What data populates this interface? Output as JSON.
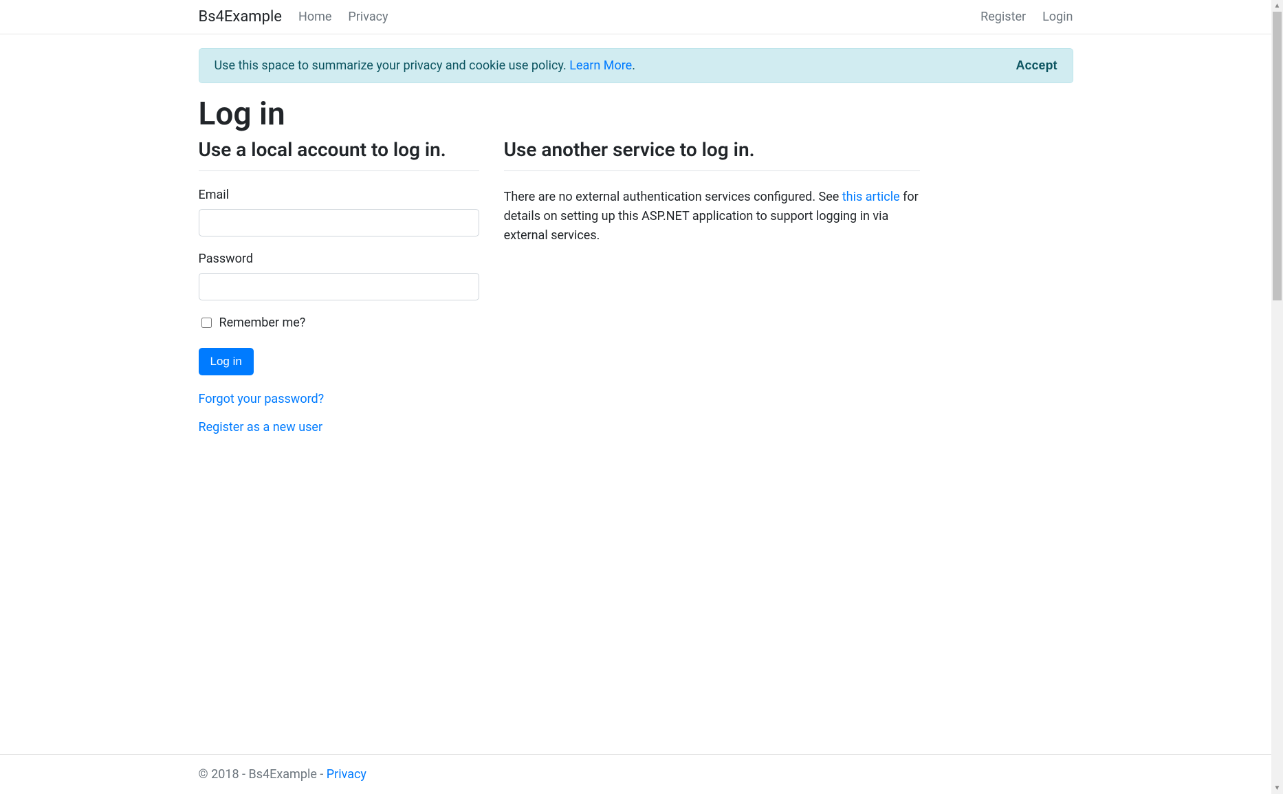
{
  "nav": {
    "brand": "Bs4Example",
    "left": [
      {
        "label": "Home"
      },
      {
        "label": "Privacy"
      }
    ],
    "right": [
      {
        "label": "Register"
      },
      {
        "label": "Login"
      }
    ]
  },
  "alert": {
    "text_prefix": "Use this space to summarize your privacy and cookie use policy. ",
    "learn_more_label": "Learn More",
    "text_suffix": ".",
    "accept_label": "Accept"
  },
  "page": {
    "title": "Log in"
  },
  "local": {
    "heading": "Use a local account to log in.",
    "email_label": "Email",
    "email_value": "",
    "password_label": "Password",
    "password_value": "",
    "remember_label": "Remember me?",
    "remember_checked": false,
    "submit_label": "Log in",
    "forgot_label": "Forgot your password?",
    "register_label": "Register as a new user"
  },
  "external": {
    "heading": "Use another service to log in.",
    "para_prefix": "There are no external authentication services configured. See ",
    "article_link_label": "this article",
    "para_suffix": " for details on setting up this ASP.NET application to support logging in via external services."
  },
  "footer": {
    "text_prefix": "© 2018 - Bs4Example - ",
    "privacy_label": "Privacy"
  }
}
